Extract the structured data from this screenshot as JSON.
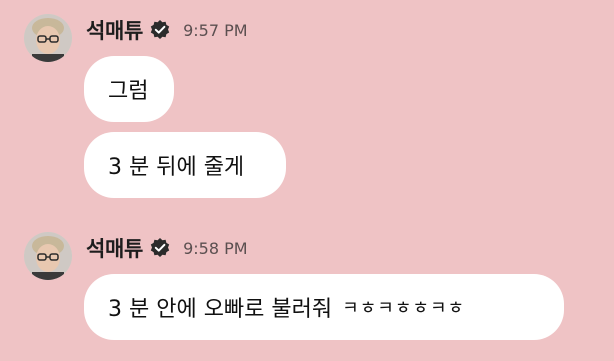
{
  "chat": {
    "background_color": "#efc3c5",
    "groups": [
      {
        "sender": "석매튜",
        "verified_icon": "verified-badge-icon",
        "time": "9:57 PM",
        "messages": [
          {
            "text": "그럼"
          },
          {
            "text": "3 분 뒤에 줄게"
          }
        ]
      },
      {
        "sender": "석매튜",
        "verified_icon": "verified-badge-icon",
        "time": "9:58 PM",
        "messages": [
          {
            "text": "3 분 안에 오빠로 불러줘",
            "suffix": "ㅋㅎㅋㅎㅎㅋㅎ"
          }
        ]
      }
    ]
  }
}
